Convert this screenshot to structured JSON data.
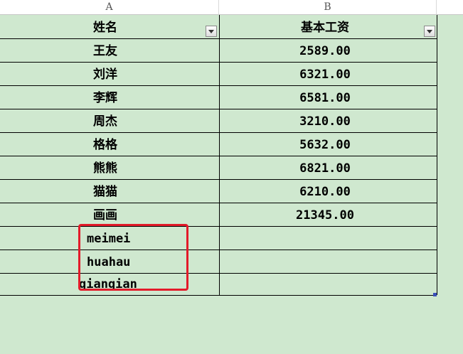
{
  "sheet": {
    "columns": [
      "A",
      "B"
    ],
    "header": {
      "name": "姓名",
      "salary": "基本工资"
    },
    "rows": [
      {
        "name": "王友",
        "salary": "2589.00"
      },
      {
        "name": "刘洋",
        "salary": "6321.00"
      },
      {
        "name": "李辉",
        "salary": "6581.00"
      },
      {
        "name": "周杰",
        "salary": "3210.00"
      },
      {
        "name": "格格",
        "salary": "5632.00"
      },
      {
        "name": "熊熊",
        "salary": "6821.00"
      },
      {
        "name": "猫猫",
        "salary": "6210.00"
      },
      {
        "name": "画画",
        "salary": "21345.00"
      }
    ],
    "extra_names": [
      "meimei",
      "huahau",
      "qianqian"
    ]
  },
  "colors": {
    "sheet_bg": "#cfe8cf",
    "highlight": "#e31b2a"
  }
}
